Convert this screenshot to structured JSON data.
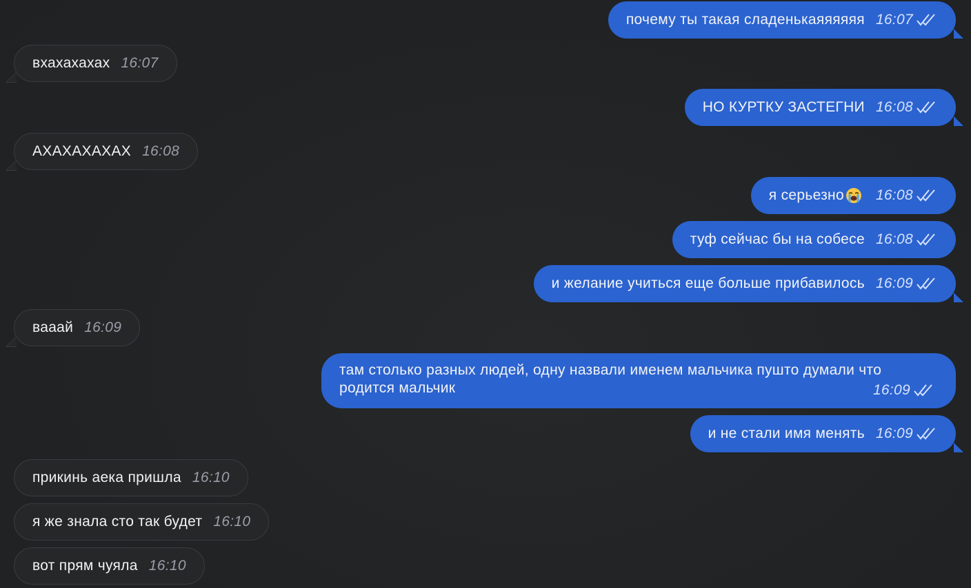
{
  "messages": [
    {
      "dir": "out",
      "text": "почему ты такая сладенькаяяяяяя",
      "time": "16:07",
      "read_icon": "double-check-icon"
    },
    {
      "dir": "in",
      "text": "вхахахахах",
      "time": "16:07"
    },
    {
      "dir": "out",
      "text": "НО КУРТКУ ЗАСТЕГНИ",
      "time": "16:08",
      "read_icon": "double-check-icon"
    },
    {
      "dir": "in",
      "text": "АХАХАХАХАХ",
      "time": "16:08"
    },
    {
      "dir": "out",
      "text": "я серьезно",
      "emoji": "loudly-crying-face-emoji",
      "time": "16:08",
      "read_icon": "double-check-icon"
    },
    {
      "dir": "out",
      "text": "туф сейчас бы на собесе",
      "time": "16:08",
      "read_icon": "double-check-icon"
    },
    {
      "dir": "out",
      "text": "и желание учиться еще больше прибавилось",
      "time": "16:09",
      "read_icon": "double-check-icon"
    },
    {
      "dir": "in",
      "text": "вааай",
      "time": "16:09"
    },
    {
      "dir": "out",
      "text_lines": [
        "там столько разных людей, одну назвали именем мальчика пушто думали что",
        "родится мальчик"
      ],
      "time": "16:09",
      "read_icon": "double-check-icon"
    },
    {
      "dir": "out",
      "text": "и не стали имя менять",
      "time": "16:09",
      "read_icon": "double-check-icon"
    },
    {
      "dir": "in",
      "text": "прикинь аека пришла",
      "time": "16:10"
    },
    {
      "dir": "in",
      "text": "я же знала сто так будет",
      "time": "16:10"
    },
    {
      "dir": "in",
      "text": "вот прям чуяла",
      "time": "16:10"
    }
  ],
  "colors": {
    "background": "#222426",
    "incoming_bubble": "#262729",
    "outgoing_bubble": "#2b63d0",
    "text": "#f2f3f5"
  }
}
